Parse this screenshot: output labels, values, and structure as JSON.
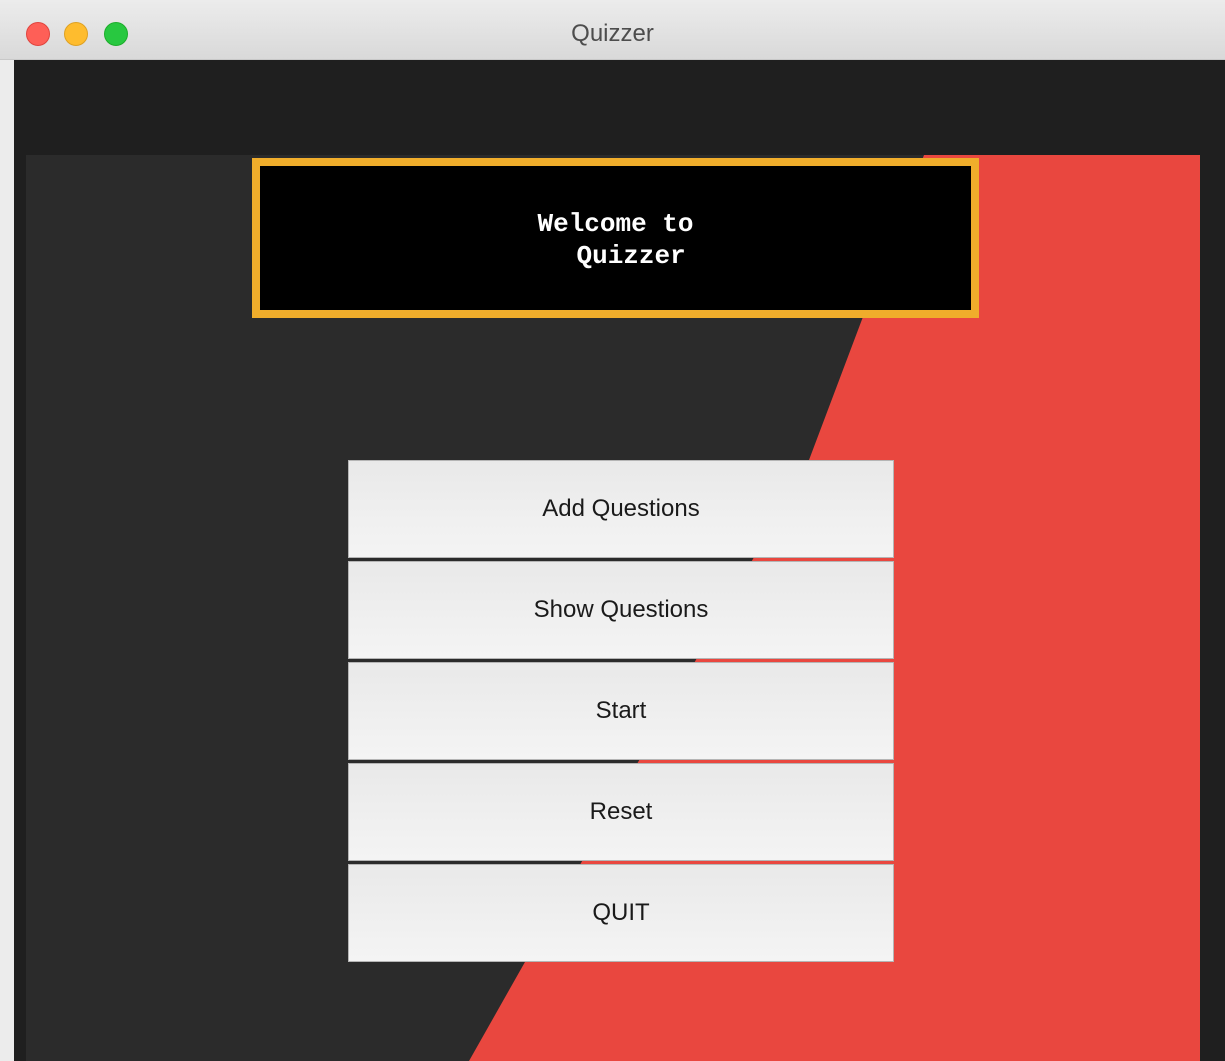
{
  "window": {
    "title": "Quizzer"
  },
  "welcome": {
    "text": "Welcome to\n  Quizzer"
  },
  "menu": {
    "buttons": [
      {
        "label": "Add Questions"
      },
      {
        "label": "Show Questions"
      },
      {
        "label": "Start"
      },
      {
        "label": "Reset"
      },
      {
        "label": "QUIT"
      }
    ]
  },
  "colors": {
    "background_dark": "#2a2a2a",
    "background_red": "#e9473f",
    "welcome_border": "#f0ad2b",
    "welcome_fill": "#000000"
  }
}
